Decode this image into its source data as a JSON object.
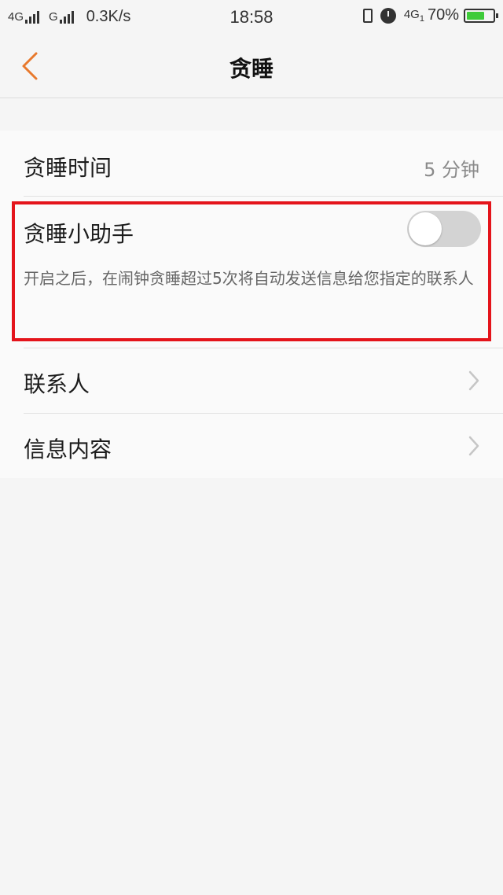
{
  "status_bar": {
    "net1": "4G",
    "net2": "G",
    "speed": "0.3K/s",
    "time": "18:58",
    "net3": "4G",
    "net3_sub": "1",
    "battery_percent_text": "70%",
    "battery_level": 0.7,
    "battery_color": "#3ecb3a",
    "icons": [
      "signal-icon",
      "signal-icon",
      "vibrate-icon",
      "alarm-clock-icon",
      "battery-icon"
    ]
  },
  "nav": {
    "title": "贪睡",
    "back_icon": "chevron-left-icon",
    "accent": "#e8792d"
  },
  "settings": {
    "snooze_time": {
      "label": "贪睡时间",
      "value": "5 分钟"
    },
    "snooze_assistant": {
      "label": "贪睡小助手",
      "enabled": false,
      "description": "开启之后，在闹钟贪睡超过5次将自动发送信息给您指定的联系人"
    },
    "contacts": {
      "label": "联系人",
      "icon": "chevron-right-icon"
    },
    "message_content": {
      "label": "信息内容",
      "icon": "chevron-right-icon"
    }
  },
  "highlight_color": "#e4141b"
}
